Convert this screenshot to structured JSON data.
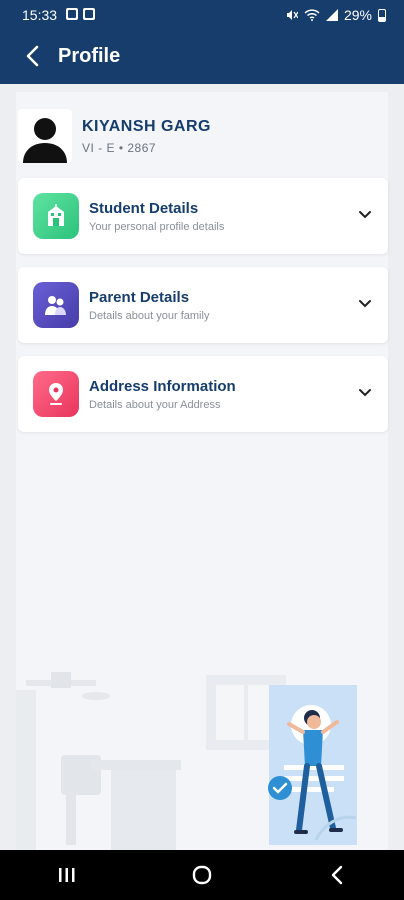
{
  "status_bar": {
    "time": "15:33",
    "battery": "29%"
  },
  "header": {
    "title": "Profile"
  },
  "profile": {
    "name": "KIYANSH GARG",
    "class_info": "VI - E  •  2867"
  },
  "sections": [
    {
      "title": "Student Details",
      "subtitle": "Your personal profile details",
      "color": "#3dd68c"
    },
    {
      "title": "Parent Details",
      "subtitle": "Details about your family",
      "color": "#5b4fbf"
    },
    {
      "title": "Address Information",
      "subtitle": "Details about your Address",
      "color": "#f2456b"
    }
  ],
  "colors": {
    "header_bg": "#173d6d",
    "accent_text": "#173d6d"
  }
}
